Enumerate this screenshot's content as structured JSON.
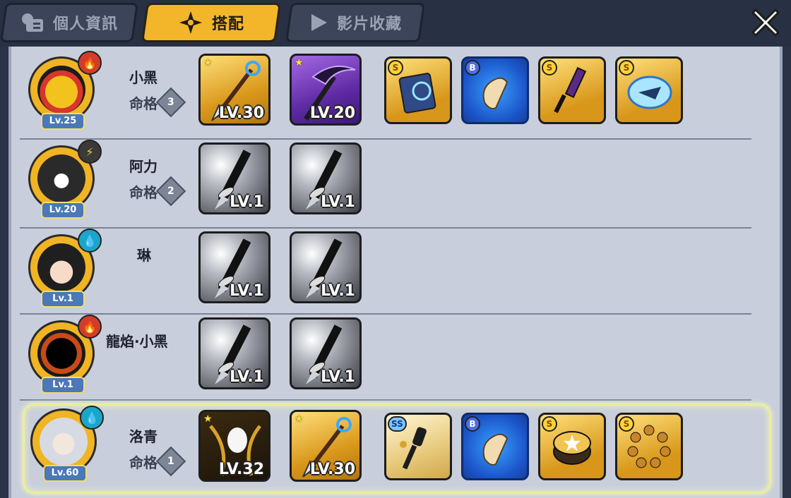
{
  "tabs": [
    {
      "label": "個人資訊",
      "icon": "profile-card-icon",
      "active": false
    },
    {
      "label": "搭配",
      "icon": "shuriken-icon",
      "active": true
    },
    {
      "label": "影片收藏",
      "icon": "play-icon",
      "active": false
    }
  ],
  "close_icon": "close-x-icon",
  "colors": {
    "tab_active": "#f3b62b",
    "panel_bg": "#c8cedc",
    "badge_blue": "#4a78b8",
    "highlight": "#e9ef9a"
  },
  "characters": [
    {
      "name": "小黑",
      "level": "Lv.25",
      "element": "fire",
      "fate_label": "命格",
      "fate_value": "3",
      "weapons": [
        {
          "level": "LV.30",
          "rarity": "gold",
          "starred": true,
          "icon": "trident-spear-icon"
        },
        {
          "level": "LV.20",
          "rarity": "purple",
          "starred": true,
          "icon": "scythe-icon"
        }
      ],
      "accessories": [
        {
          "grade": "S",
          "style": "gold",
          "icon": "magic-book-icon"
        },
        {
          "grade": "B",
          "style": "blue",
          "icon": "scroll-icon"
        },
        {
          "grade": "S",
          "style": "gold",
          "icon": "dagger-hilt-icon"
        },
        {
          "grade": "S",
          "style": "gold",
          "icon": "ice-wing-icon"
        }
      ],
      "highlighted": false
    },
    {
      "name": "阿力",
      "level": "Lv.20",
      "element": "thunder",
      "fate_label": "命格",
      "fate_value": "2",
      "weapons": [
        {
          "level": "LV.1",
          "rarity": "grey",
          "starred": false,
          "icon": "katana-hilt-icon"
        },
        {
          "level": "LV.1",
          "rarity": "grey",
          "starred": false,
          "icon": "katana-hilt-icon"
        }
      ],
      "accessories": [],
      "highlighted": false
    },
    {
      "name": "琳",
      "level": "Lv.1",
      "element": "water",
      "fate_label": "",
      "fate_value": "",
      "weapons": [
        {
          "level": "LV.1",
          "rarity": "grey",
          "starred": false,
          "icon": "katana-hilt-icon"
        },
        {
          "level": "LV.1",
          "rarity": "grey",
          "starred": false,
          "icon": "katana-hilt-icon"
        }
      ],
      "accessories": [],
      "highlighted": false
    },
    {
      "name": "龍焰·小黑",
      "level": "Lv.1",
      "element": "fire",
      "fate_label": "",
      "fate_value": "",
      "weapons": [
        {
          "level": "LV.1",
          "rarity": "grey",
          "starred": false,
          "icon": "katana-hilt-icon"
        },
        {
          "level": "LV.1",
          "rarity": "grey",
          "starred": false,
          "icon": "katana-hilt-icon"
        }
      ],
      "accessories": [],
      "highlighted": false
    },
    {
      "name": "洛青",
      "level": "Lv.60",
      "element": "water",
      "fate_label": "命格",
      "fate_value": "1",
      "weapons": [
        {
          "level": "LV.32",
          "rarity": "gold",
          "starred": true,
          "icon": "dragon-blade-icon"
        },
        {
          "level": "LV.30",
          "rarity": "gold",
          "starred": true,
          "icon": "trident-spear-icon"
        }
      ],
      "accessories": [
        {
          "grade": "SS",
          "style": "silver",
          "icon": "scepter-icon"
        },
        {
          "grade": "B",
          "style": "blue",
          "icon": "scroll-icon"
        },
        {
          "grade": "S",
          "style": "gold",
          "icon": "star-drum-icon"
        },
        {
          "grade": "S",
          "style": "gold",
          "icon": "bead-bracelet-icon"
        }
      ],
      "highlighted": true
    }
  ]
}
